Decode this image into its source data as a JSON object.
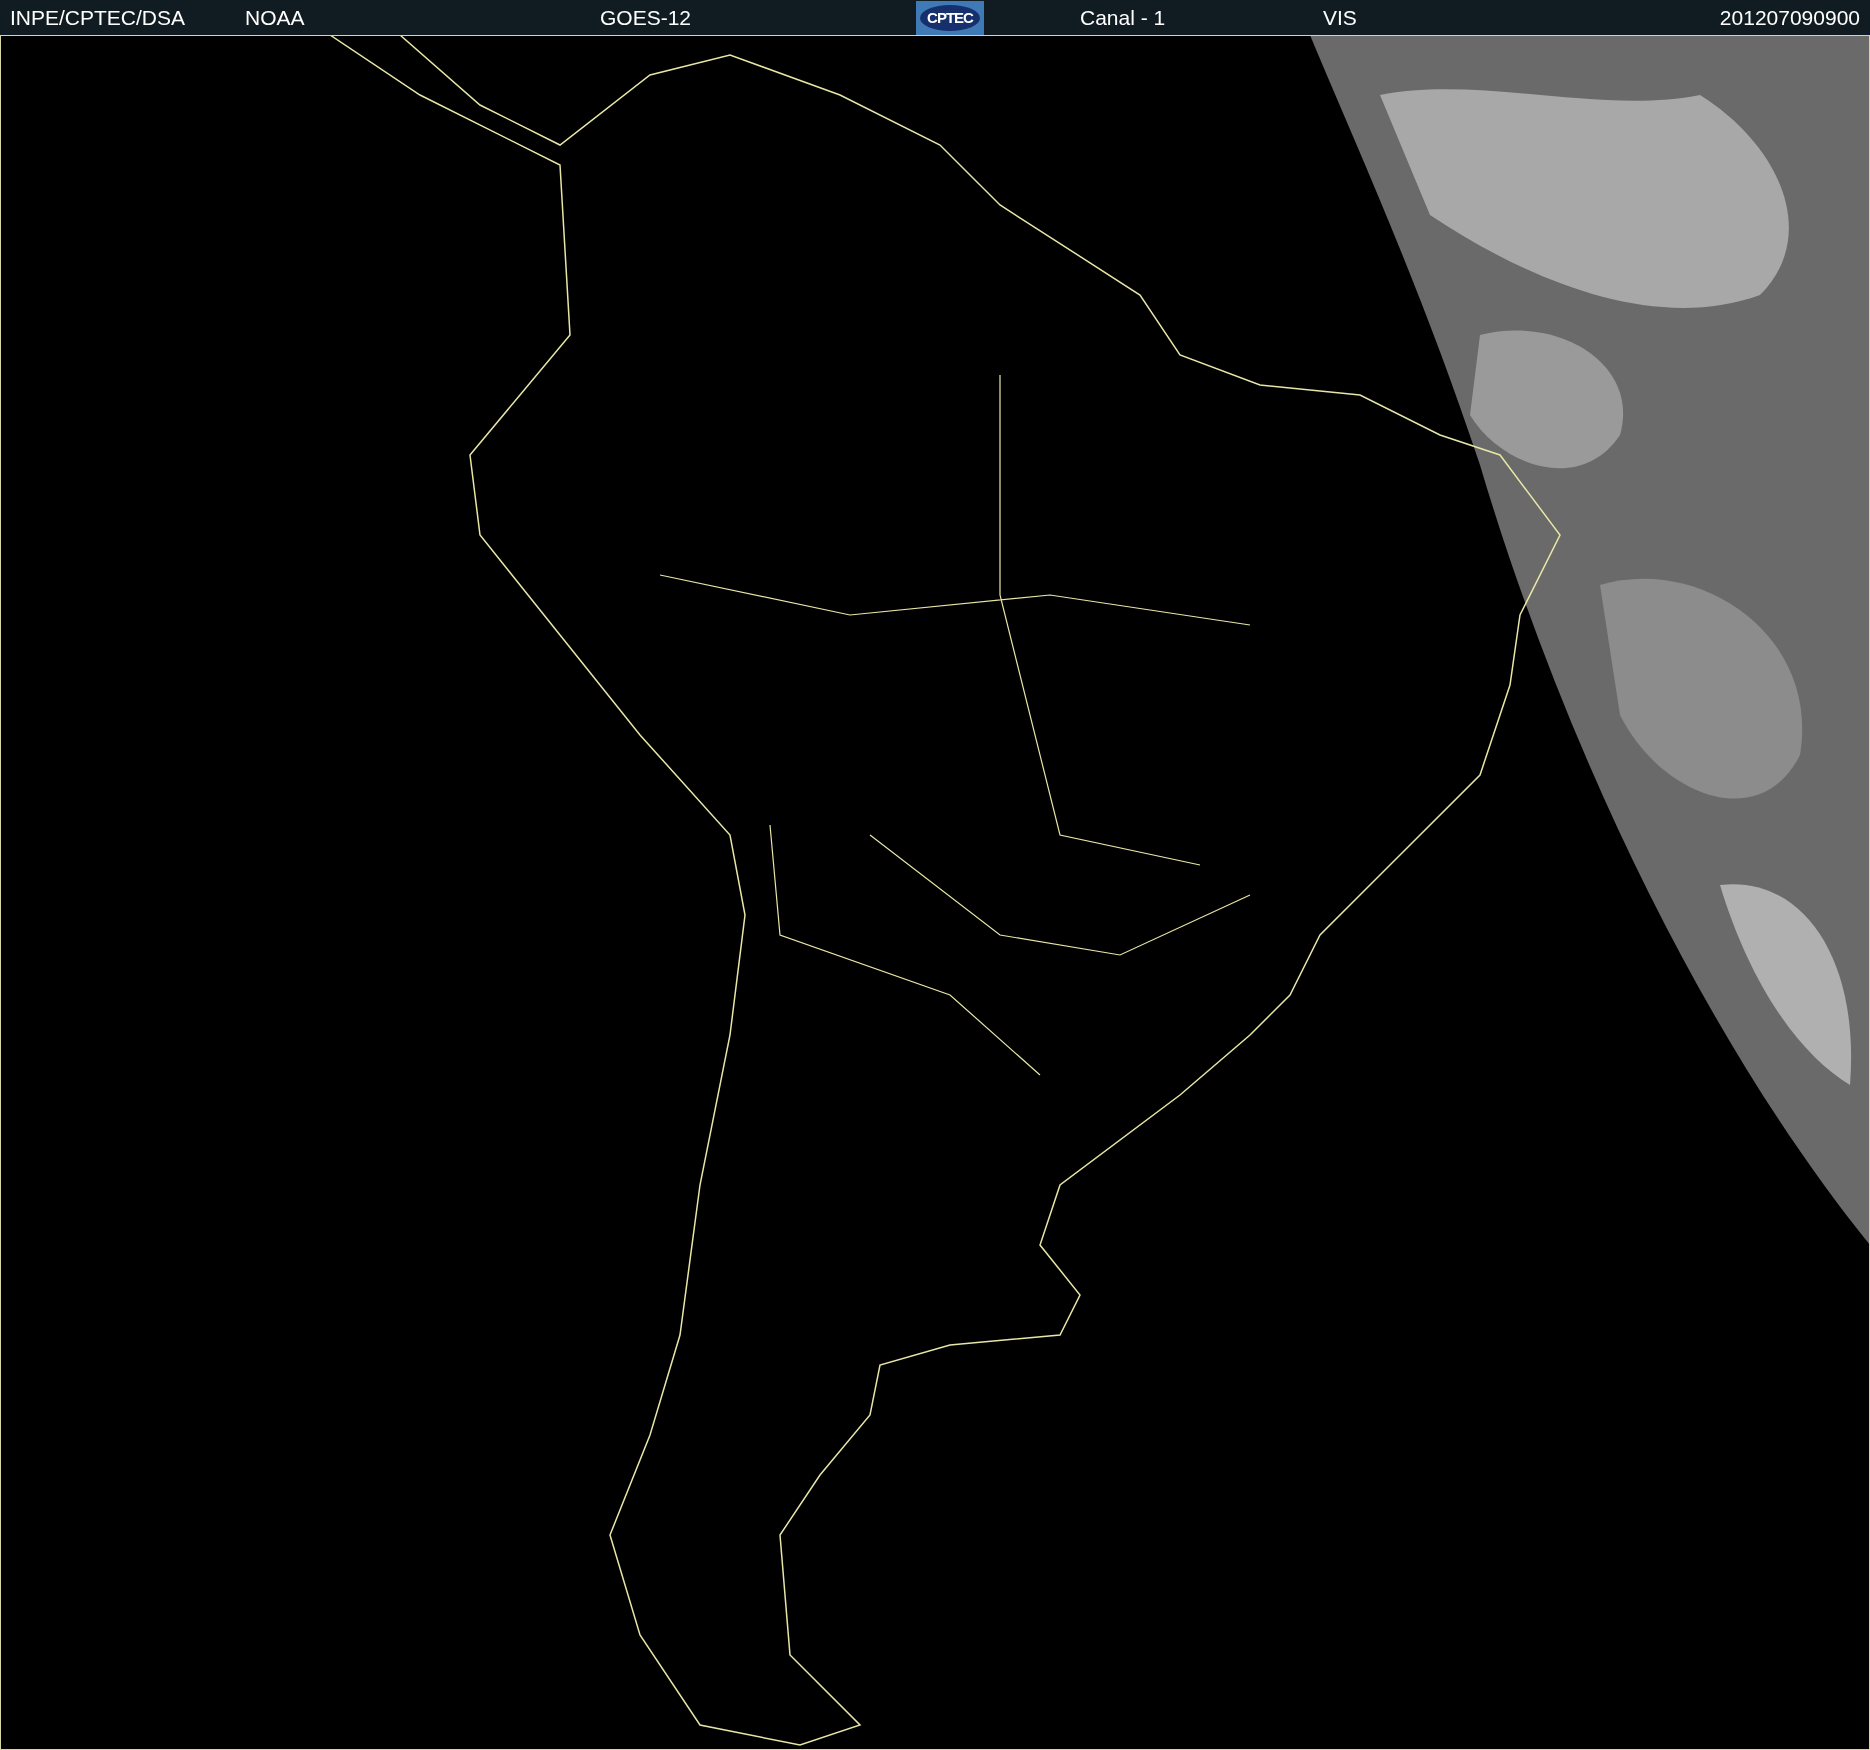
{
  "header": {
    "source": "INPE/CPTEC/DSA",
    "agency": "NOAA",
    "satellite": "GOES-12",
    "logo": "CPTEC",
    "channel": "Canal - 1",
    "band": "VIS",
    "timestamp": "201207090900"
  }
}
